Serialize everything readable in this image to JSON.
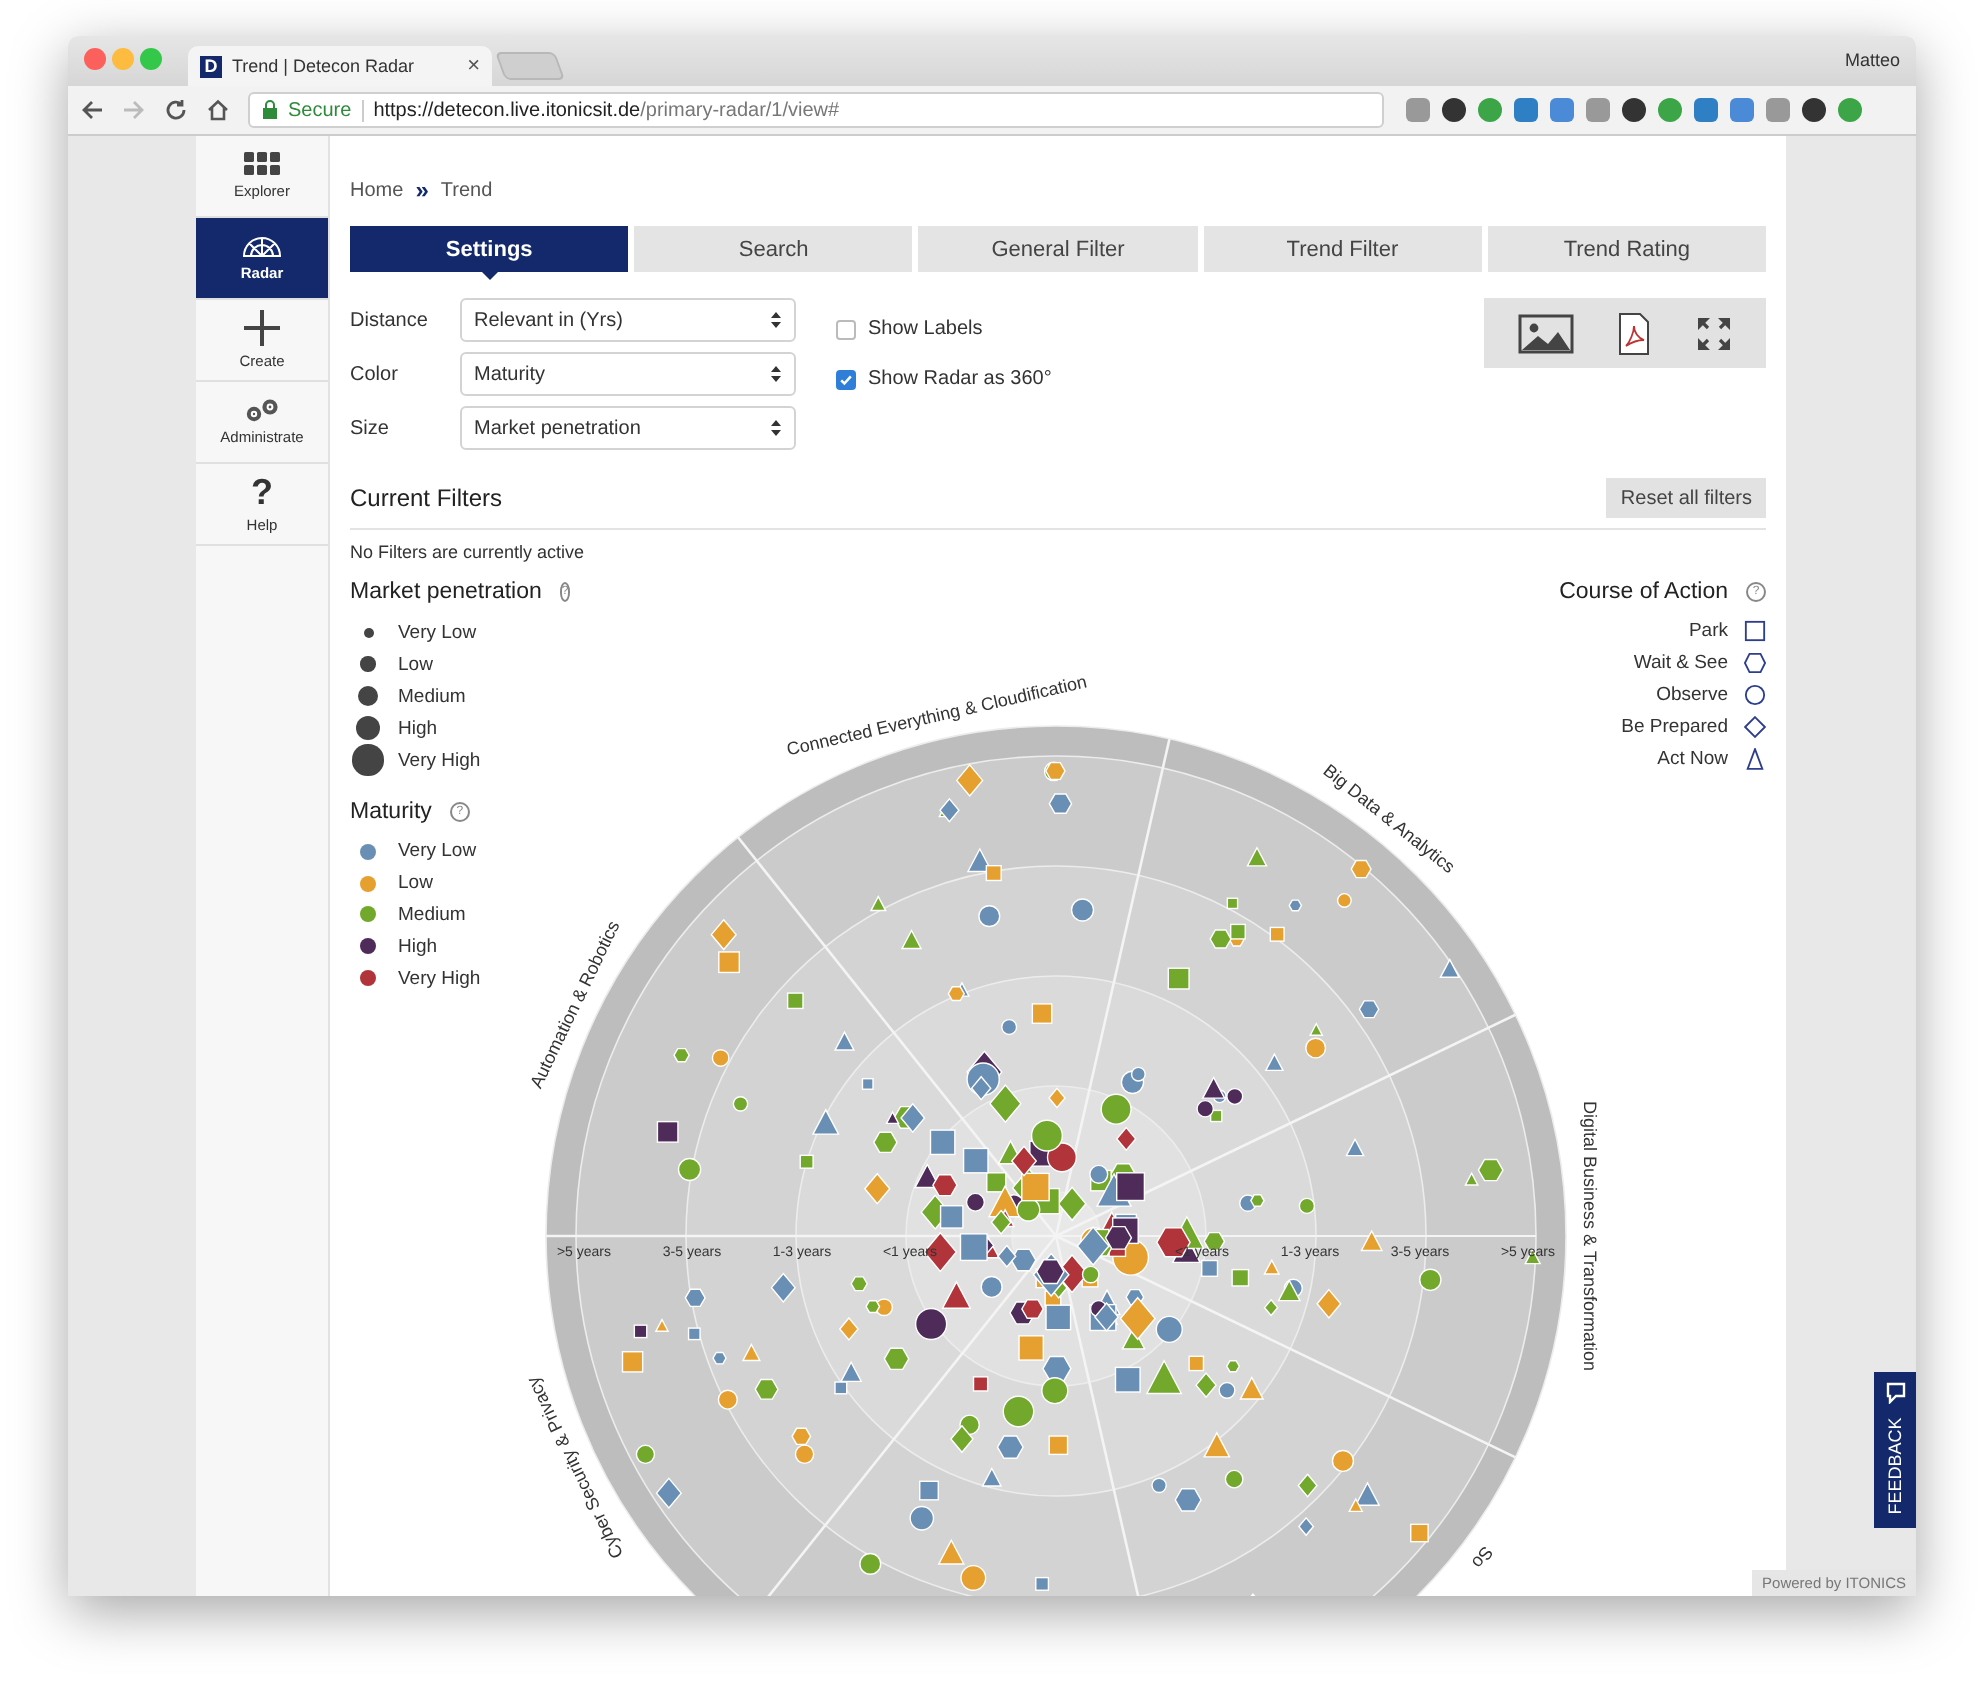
{
  "browser": {
    "tab_title": "Trend | Detecon Radar",
    "favicon_letter": "D",
    "tab_close": "×",
    "user": "Matteo",
    "secure": "Secure",
    "url_host": "https://detecon.live.itonicsit.de",
    "url_path": "/primary-radar/1/view#"
  },
  "sidebar": {
    "items": [
      {
        "label": "Explorer",
        "selected": false
      },
      {
        "label": "Radar",
        "selected": true
      },
      {
        "label": "Create",
        "selected": false
      },
      {
        "label": "Administrate",
        "selected": false
      },
      {
        "label": "Help",
        "glyph": "?",
        "selected": false
      }
    ]
  },
  "breadcrumb": {
    "items": [
      "Home",
      "Trend"
    ],
    "separator": "»"
  },
  "tabs": [
    {
      "label": "Settings",
      "selected": true
    },
    {
      "label": "Search",
      "selected": false
    },
    {
      "label": "General Filter",
      "selected": false
    },
    {
      "label": "Trend Filter",
      "selected": false
    },
    {
      "label": "Trend Rating",
      "selected": false
    }
  ],
  "settings": [
    {
      "label": "Distance",
      "value": "Relevant in (Yrs)"
    },
    {
      "label": "Color",
      "value": "Maturity"
    },
    {
      "label": "Size",
      "value": "Market penetration"
    }
  ],
  "options": [
    {
      "label": "Show Labels",
      "checked": false
    },
    {
      "label": "Show Radar as 360°",
      "checked": true
    }
  ],
  "filters": {
    "title": "Current Filters",
    "reset_button": "Reset all filters",
    "message": "No Filters are currently active"
  },
  "market_penetration": {
    "title": "Market penetration",
    "help": "?",
    "items": [
      "Very Low",
      "Low",
      "Medium",
      "High",
      "Very High"
    ]
  },
  "maturity": {
    "title": "Maturity",
    "help": "?",
    "items": [
      {
        "label": "Very Low",
        "color": "#6a8fb5"
      },
      {
        "label": "Low",
        "color": "#e6a030"
      },
      {
        "label": "Medium",
        "color": "#72a82c"
      },
      {
        "label": "High",
        "color": "#4f2b5a"
      },
      {
        "label": "Very High",
        "color": "#b0343a"
      }
    ]
  },
  "course_of_action": {
    "title": "Course of Action",
    "help": "?",
    "items": [
      {
        "label": "Park",
        "kind": "square"
      },
      {
        "label": "Wait & See",
        "kind": "hexagon"
      },
      {
        "label": "Observe",
        "kind": "circle"
      },
      {
        "label": "Be Prepared",
        "kind": "diamond"
      },
      {
        "label": "Act Now",
        "kind": "triangle"
      }
    ]
  },
  "radar": {
    "sectors": [
      {
        "label": "Automation & Robotics"
      },
      {
        "label": "Connected Everything & Cloudification"
      },
      {
        "label": "Big Data & Analytics"
      },
      {
        "label": "Digital Business & Transformation"
      },
      {
        "label": "So"
      },
      {
        "label": "Cyber Security & Privacy"
      }
    ],
    "axis_labels_left": [
      ">5 years",
      "3-5 years",
      "1-3 years",
      "<1 years"
    ],
    "axis_labels_right": [
      "<1 years",
      "1-3 years",
      "3-5 years",
      ">5 years"
    ]
  },
  "feedback": "FEEDBACK",
  "powered_by": "Powered by ITONICS"
}
